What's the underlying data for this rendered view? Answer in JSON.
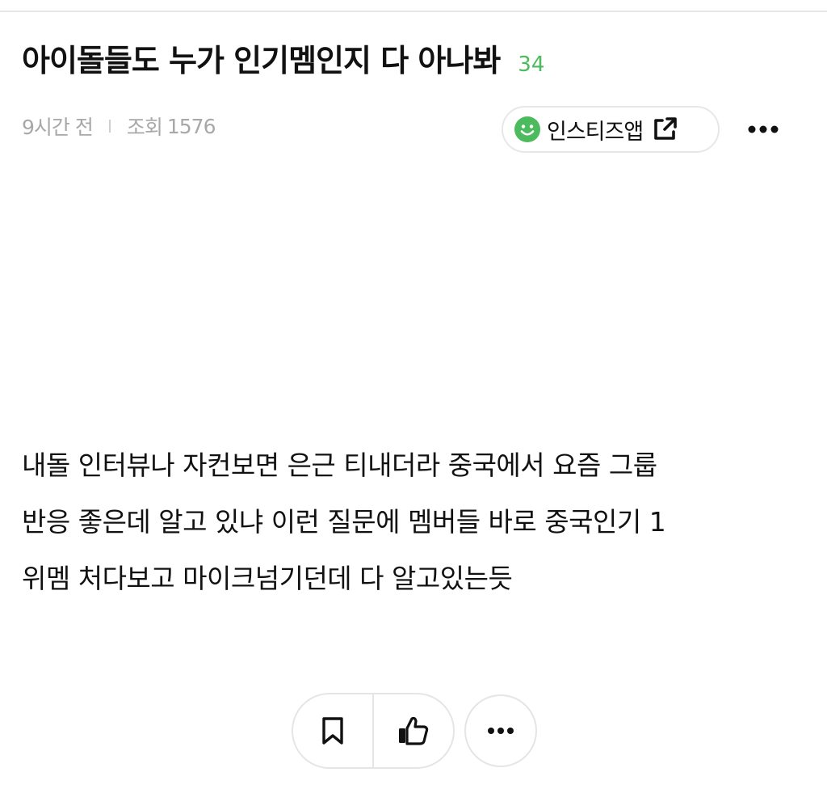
{
  "post": {
    "title": "아이돌들도 누가 인기멤인지 다 아나봐",
    "comment_count": "34",
    "time_ago": "9시간 전",
    "views_label": "조회",
    "views_count": "1576",
    "body_lines": [
      "내돌 인터뷰나 자컨보면 은근 티내더라 중국에서 요즘 그룹",
      "반응 좋은데 알고 있냐 이런 질문에 멤버들 바로 중국인기 1",
      "위멤 처다보고 마이크넘기던데 다 알고있는듯"
    ]
  },
  "app_chip": {
    "label": "인스티즈앱",
    "icon_left": "smile-icon",
    "icon_right": "external-link-icon"
  },
  "colors": {
    "accent_green": "#4cbb5d",
    "meta_gray": "#a8a8a8",
    "border_gray": "#e5e5e5"
  },
  "actions": {
    "icons": [
      "bookmark-icon",
      "thumbs-up-icon",
      "more-horizontal-icon"
    ]
  },
  "header": {
    "more_icon": "more-horizontal-icon"
  }
}
